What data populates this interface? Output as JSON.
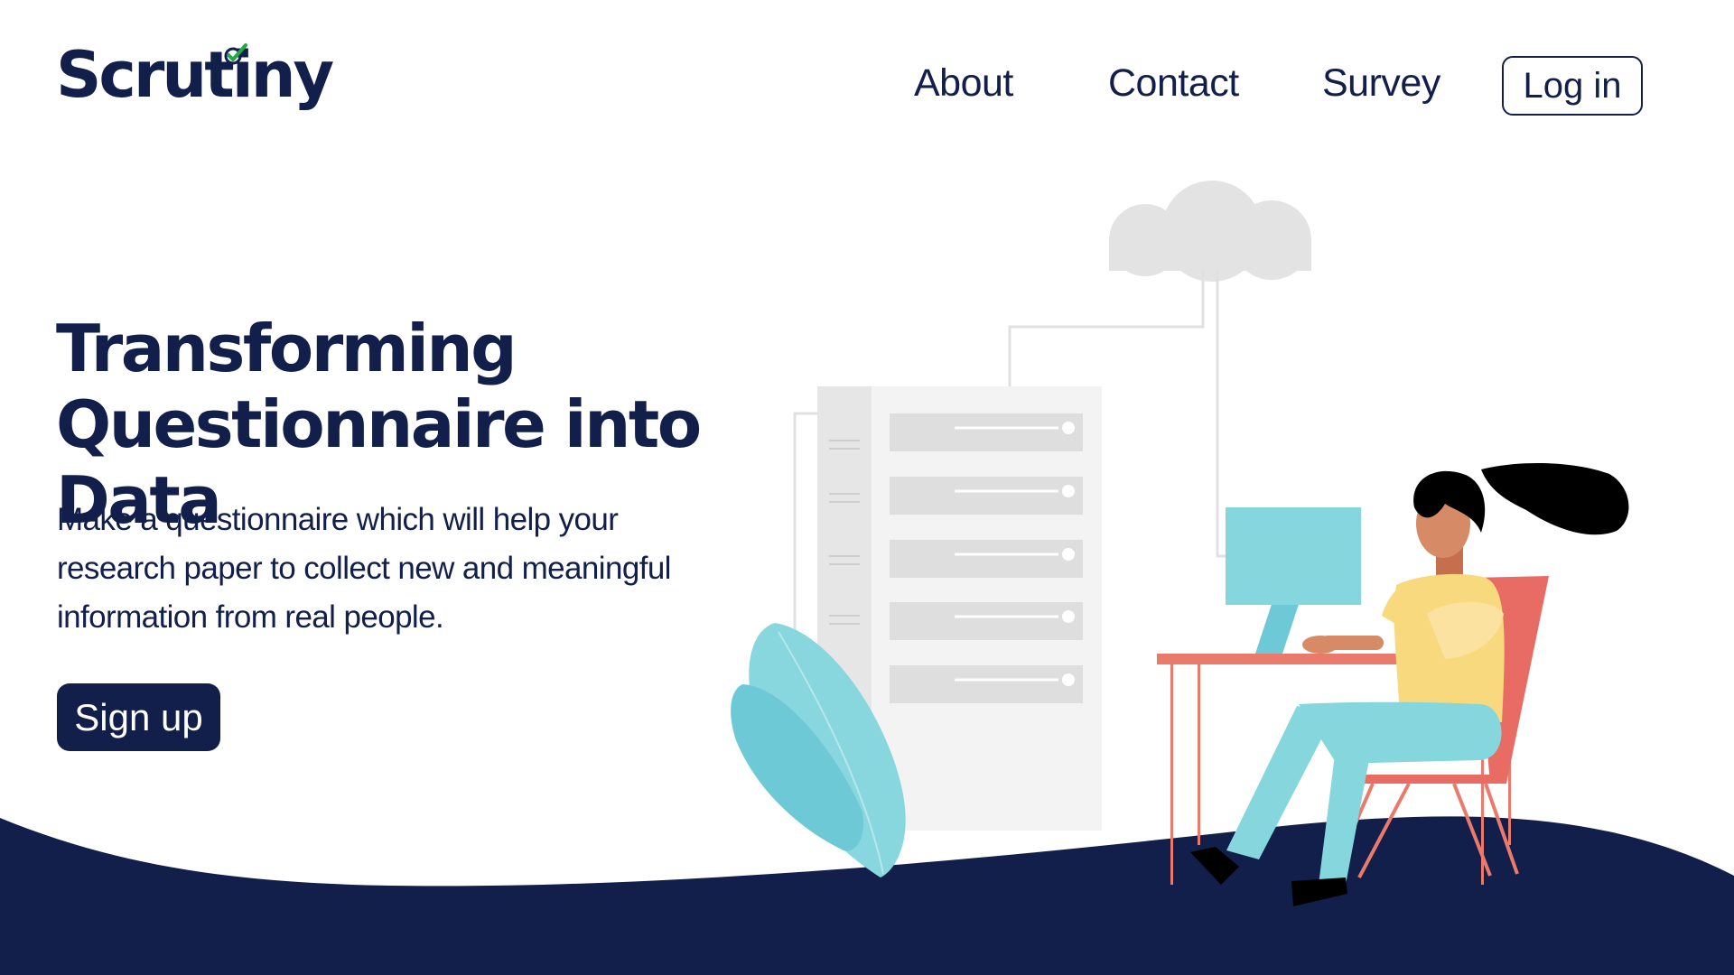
{
  "brand": {
    "name": "Scrutiny"
  },
  "nav": {
    "about": "About",
    "contact": "Contact",
    "survey": "Survey",
    "login": "Log in"
  },
  "hero": {
    "title_line1": "Transforming",
    "title_line2": "Questionnaire into Data",
    "description": "Make a questionnaire which will help your research paper to collect new and meaningful information from real people.",
    "signup": "Sign up"
  },
  "colors": {
    "navy": "#121f4a",
    "check_green": "#22a84a",
    "teal": "#86d6dd",
    "coral": "#ea7a6c",
    "yellow": "#f8d97e",
    "gray_panel": "#f2f2f2"
  },
  "icons": {
    "logo_check": "check-mark-icon"
  }
}
